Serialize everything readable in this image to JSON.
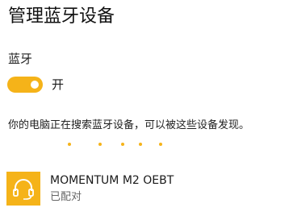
{
  "page_title": "管理蓝牙设备",
  "bluetooth": {
    "label": "蓝牙",
    "toggle_on": true,
    "toggle_state_label": "开"
  },
  "status_text": "你的电脑正在搜索蓝牙设备，可以被这些设备发现。",
  "devices": [
    {
      "name": "MOMENTUM M2 OEBT",
      "status": "已配对",
      "icon": "headset-icon"
    }
  ],
  "colors": {
    "accent": "#F5B319",
    "toggle_knob": "#FFFFFF"
  }
}
